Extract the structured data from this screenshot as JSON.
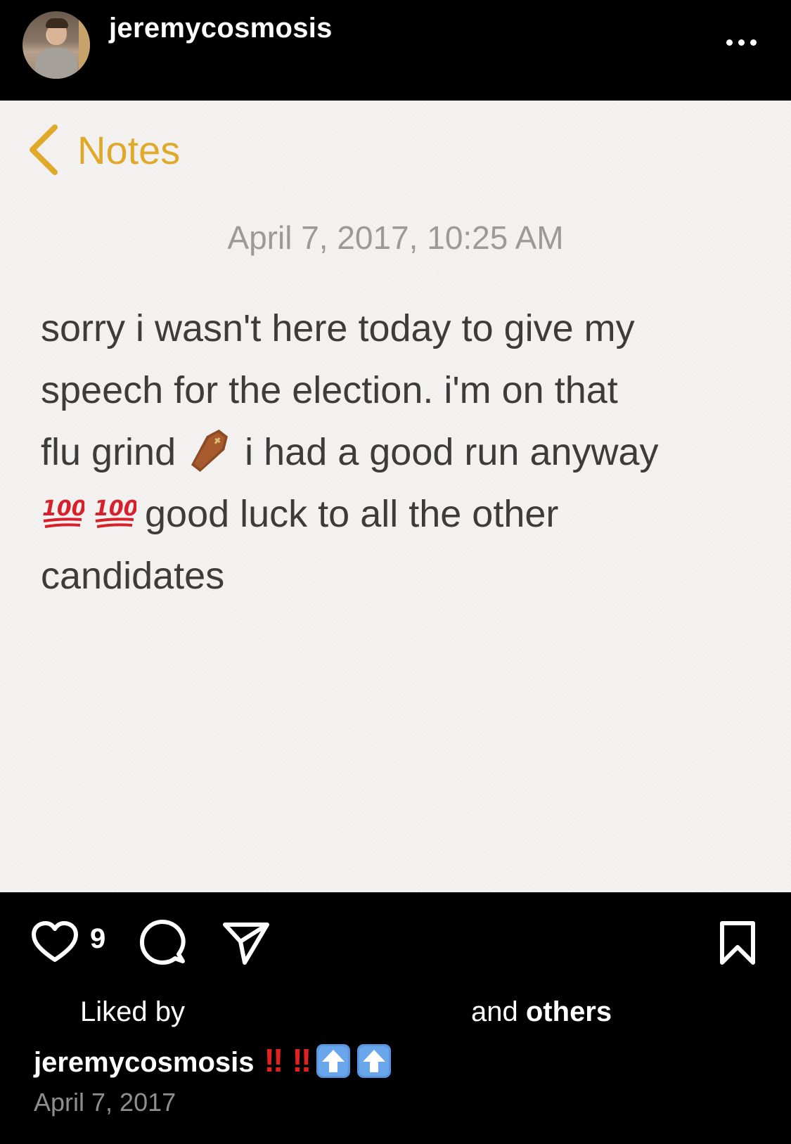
{
  "header": {
    "username": "jeremycosmosis",
    "more_icon": "more-horizontal-icon"
  },
  "note": {
    "back_label": "Notes",
    "back_icon": "chevron-left-icon",
    "accent_color": "#e0a92a",
    "date": "April 7, 2017, 10:25 AM",
    "lines": [
      "sorry i wasn't here today to give my",
      "speech for the election. i'm on that",
      "flu grind",
      "i had a good run anyway",
      "good luck to all the other",
      "candidates"
    ],
    "emojis": [
      "coffin-icon",
      "hundred-points-icon",
      "hundred-points-icon"
    ]
  },
  "actions": {
    "like_icon": "heart-icon",
    "like_count": "9",
    "comment_icon": "comment-icon",
    "share_icon": "send-icon",
    "save_icon": "bookmark-icon"
  },
  "likes": {
    "prefix": "Liked by",
    "and_text": "and",
    "others_text": "others"
  },
  "caption": {
    "username": "jeremycosmosis",
    "marks": [
      "‼",
      "‼"
    ],
    "emojis": [
      "up-arrow-icon",
      "up-arrow-icon"
    ],
    "mark_color": "#e2221f"
  },
  "post_date": "April 7, 2017"
}
